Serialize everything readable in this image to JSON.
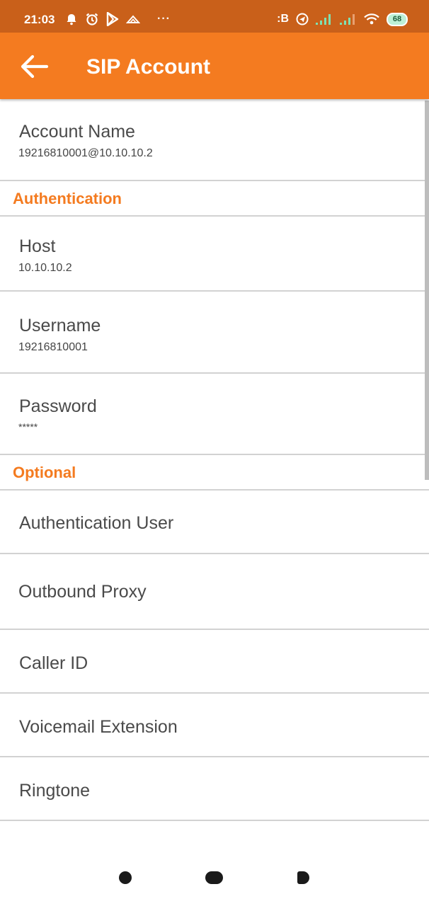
{
  "status_bar": {
    "time": "21:03",
    "more": "···",
    "network_label": ":B",
    "battery": "68"
  },
  "app_bar": {
    "title": "SIP Account",
    "back_icon": "arrow-left-icon",
    "bg_color": "#f47b20"
  },
  "account": {
    "title": "Account Name",
    "value": "19216810001@10.10.10.2"
  },
  "sections": {
    "authentication": "Authentication",
    "optional": "Optional",
    "color": "#f47b20"
  },
  "authentication_items": [
    {
      "title": "Host",
      "value": "10.10.10.2"
    },
    {
      "title": "Username",
      "value": "19216810001"
    },
    {
      "title": "Password",
      "value": "*****"
    }
  ],
  "optional_items": [
    {
      "title": "Authentication User"
    },
    {
      "title": "Outbound Proxy"
    },
    {
      "title": "Caller ID"
    },
    {
      "title": "Voicemail Extension"
    },
    {
      "title": "Ringtone"
    }
  ],
  "nav_bar": {
    "buttons": [
      "recents-button",
      "home-button",
      "back-button"
    ]
  }
}
